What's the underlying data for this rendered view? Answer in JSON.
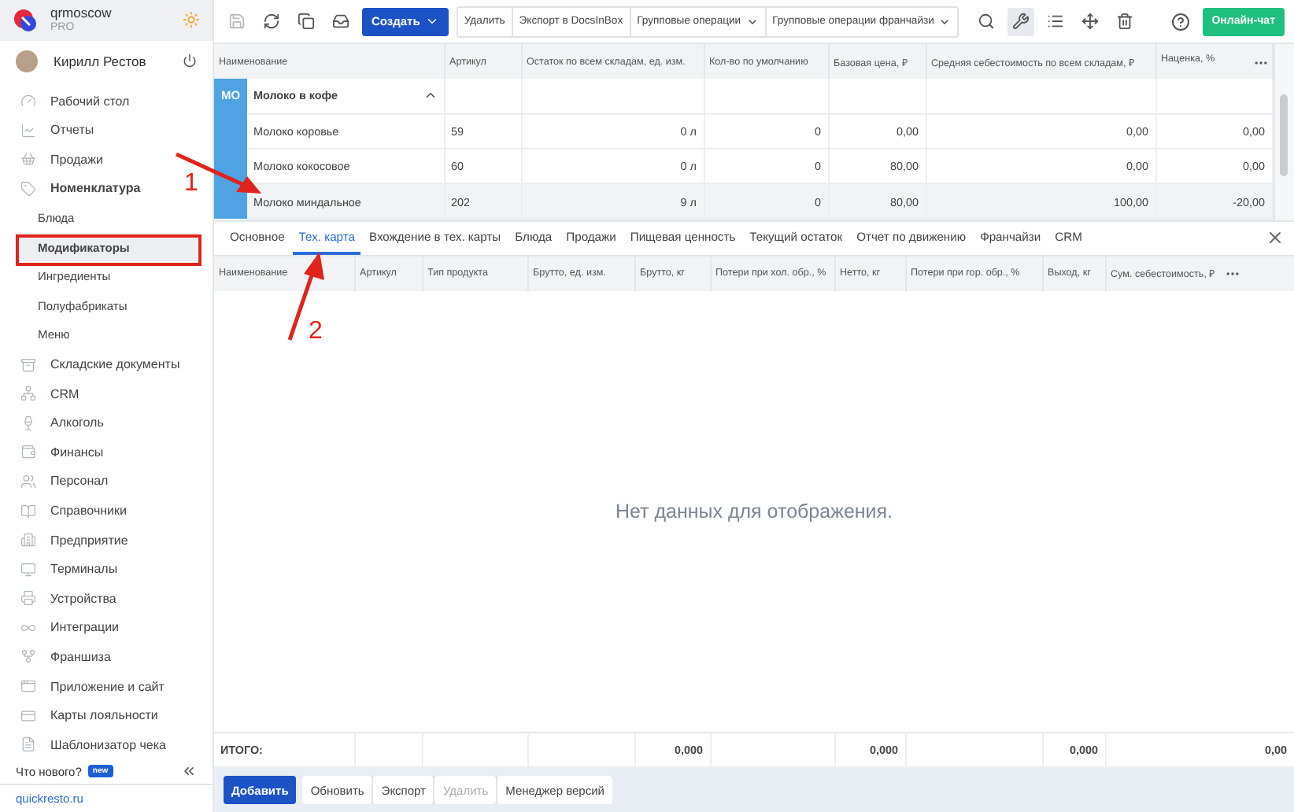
{
  "sidebar": {
    "org": {
      "name": "qrmoscow",
      "plan": "PRO"
    },
    "user": {
      "name": "Кирилл Рестов"
    },
    "items": [
      {
        "label": "Рабочий стол",
        "expanded": false
      },
      {
        "label": "Отчеты",
        "expanded": false
      },
      {
        "label": "Продажи",
        "expanded": false
      },
      {
        "label": "Номенклатура",
        "expanded": true,
        "children": [
          {
            "label": "Блюда",
            "selected": false
          },
          {
            "label": "Модификаторы",
            "selected": true
          },
          {
            "label": "Ингредиенты",
            "selected": false
          },
          {
            "label": "Полуфабрикаты",
            "selected": false
          },
          {
            "label": "Меню",
            "selected": false
          }
        ]
      },
      {
        "label": "Складские документы",
        "expanded": false
      },
      {
        "label": "CRM",
        "expanded": false
      },
      {
        "label": "Алкоголь",
        "expanded": false
      },
      {
        "label": "Финансы",
        "expanded": false
      },
      {
        "label": "Персонал",
        "expanded": false
      },
      {
        "label": "Справочники",
        "expanded": false
      },
      {
        "label": "Предприятие",
        "expanded": false
      },
      {
        "label": "Терминалы",
        "expanded": false
      },
      {
        "label": "Устройства",
        "expanded": false
      },
      {
        "label": "Интеграции",
        "expanded": false
      },
      {
        "label": "Франшиза",
        "expanded": false
      },
      {
        "label": "Приложение и сайт",
        "expanded": false
      },
      {
        "label": "Карты лояльности",
        "expanded": false
      },
      {
        "label": "Шаблонизатор чека",
        "expanded": false
      }
    ],
    "whats_new": {
      "label": "Что нового?",
      "badge": "new"
    },
    "site_link": "quickresto.ru"
  },
  "toolbar": {
    "create": "Создать",
    "actions": [
      "Удалить",
      "Экспорт в DocsInBox",
      "Групповые операции",
      "Групповые операции франчайзи"
    ],
    "chat": "Онлайн-чат"
  },
  "table": {
    "columns": [
      "Наименование",
      "Артикул",
      "Остаток по всем складам, ед. изм.",
      "Кол-во по умолчанию",
      "Базовая цена, ₽",
      "Средняя себестоимость по всем складам, ₽",
      "Наценка, %"
    ],
    "group": {
      "badge": "МО",
      "name": "Молоко в кофе",
      "expanded": true
    },
    "rows": [
      {
        "cells": [
          "Молоко коровье",
          "59",
          "0 л",
          "0",
          "0,00",
          "0,00",
          "0,00"
        ],
        "selected": false
      },
      {
        "cells": [
          "Молоко кокосовое",
          "60",
          "0 л",
          "0",
          "80,00",
          "0,00",
          "0,00"
        ],
        "selected": false
      },
      {
        "cells": [
          "Молоко миндальное",
          "202",
          "9 л",
          "0",
          "80,00",
          "100,00",
          "-20,00"
        ],
        "selected": true
      }
    ]
  },
  "detail_tabs": [
    {
      "label": "Основное",
      "selected": false
    },
    {
      "label": "Тех. карта",
      "selected": true
    },
    {
      "label": "Вхождение в тех. карты",
      "selected": false
    },
    {
      "label": "Блюда",
      "selected": false
    },
    {
      "label": "Продажи",
      "selected": false
    },
    {
      "label": "Пищевая ценность",
      "selected": false
    },
    {
      "label": "Текущий остаток",
      "selected": false
    },
    {
      "label": "Отчет по движению",
      "selected": false
    },
    {
      "label": "Франчайзи",
      "selected": false
    },
    {
      "label": "CRM",
      "selected": false
    }
  ],
  "detail_table": {
    "columns": [
      "Наименование",
      "Артикул",
      "Тип продукта",
      "Брутто, ед. изм.",
      "Брутто, кг",
      "Потери при хол. обр., %",
      "Нетто, кг",
      "Потери при гор. обр., %",
      "Выход, кг",
      "Сум. себестоимость, ₽"
    ],
    "empty_message": "Нет данных для отображения.",
    "totals": {
      "label": "ИТОГО:",
      "gross_kg": "0,000",
      "net_kg": "0,000",
      "yield_kg": "0,000",
      "cost_sum": "0,00"
    }
  },
  "bottom_bar": [
    {
      "label": "Добавить",
      "kind": "primary",
      "disabled": false
    },
    {
      "label": "Обновить",
      "kind": "plain",
      "disabled": false
    },
    {
      "label": "Экспорт",
      "kind": "plain",
      "disabled": false
    },
    {
      "label": "Удалить",
      "kind": "plain",
      "disabled": true
    },
    {
      "label": "Менеджер версий",
      "kind": "plain",
      "disabled": false
    }
  ],
  "annotations": [
    {
      "label": "1"
    },
    {
      "label": "2"
    }
  ]
}
